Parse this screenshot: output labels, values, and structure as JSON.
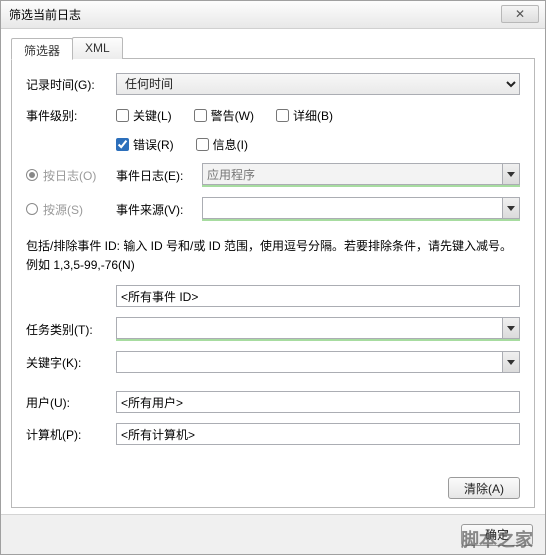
{
  "window": {
    "title": "筛选当前日志"
  },
  "tabs": [
    {
      "label": "筛选器"
    },
    {
      "label": "XML"
    }
  ],
  "form": {
    "logged": {
      "label": "记录时间(G):",
      "value": "任何时间"
    },
    "level": {
      "label": "事件级别:",
      "options": [
        "关键(L)",
        "警告(W)",
        "详细(B)",
        "错误(R)",
        "信息(I)"
      ],
      "checked": [
        false,
        false,
        false,
        true,
        false
      ]
    },
    "bylog": {
      "radio": "按日志(O)",
      "label": "事件日志(E):",
      "value": "应用程序"
    },
    "bysource": {
      "radio": "按源(S)",
      "label": "事件来源(V):"
    },
    "help": "包括/排除事件 ID: 输入 ID 号和/或 ID 范围，使用逗号分隔。若要排除条件，请先键入减号。例如 1,3,5-99,-76(N)",
    "eventid": {
      "placeholder": "<所有事件 ID>"
    },
    "task": {
      "label": "任务类别(T):"
    },
    "keywords": {
      "label": "关键字(K):"
    },
    "user": {
      "label": "用户(U):",
      "placeholder": "<所有用户>"
    },
    "computer": {
      "label": "计算机(P):",
      "placeholder": "<所有计算机>"
    },
    "clear": "清除(A)"
  },
  "footer": {
    "ok": "确定"
  },
  "watermark": "脚本之家"
}
